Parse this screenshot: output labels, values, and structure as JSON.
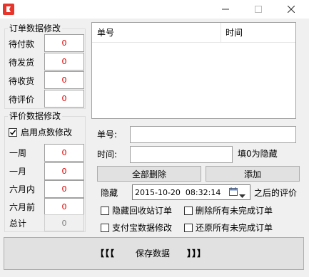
{
  "window": {
    "title": ""
  },
  "order_group": {
    "legend": "订单数据修改",
    "rows": [
      {
        "label": "待付款",
        "value": "0"
      },
      {
        "label": "待发货",
        "value": "0"
      },
      {
        "label": "待收货",
        "value": "0"
      },
      {
        "label": "待评价",
        "value": "0"
      }
    ]
  },
  "review_group": {
    "legend": "评价数据修改",
    "enable_label": "启用点数修改",
    "enable_checked": true,
    "rows": [
      {
        "label": "一周",
        "value": "0"
      },
      {
        "label": "一月",
        "value": "0"
      },
      {
        "label": "六月内",
        "value": "0"
      },
      {
        "label": "六月前",
        "value": "0"
      },
      {
        "label": "总计",
        "value": "0"
      }
    ]
  },
  "list": {
    "columns": [
      "单号",
      "时间"
    ]
  },
  "form": {
    "order_no_label": "单号:",
    "order_no_value": "",
    "time_label": "时间:",
    "time_value": "",
    "time_hint": "填0为隐藏"
  },
  "buttons": {
    "delete_all": "全部删除",
    "add": "添加"
  },
  "hide_row": {
    "label": "隐藏",
    "datetime": "2015-10-20  08:32:14",
    "suffix": "之后的评价"
  },
  "options": [
    {
      "label": "隐藏回收站订单",
      "checked": false
    },
    {
      "label": "删除所有未完成订单",
      "checked": false
    },
    {
      "label": "支付宝数据修改",
      "checked": false
    },
    {
      "label": "还原所有未完成订单",
      "checked": false
    }
  ],
  "save_button": {
    "left": "【【【",
    "label": "保存数据",
    "right": "】】】"
  },
  "colors": {
    "value_red": "#e00000",
    "icon_red": "#e8352c"
  }
}
